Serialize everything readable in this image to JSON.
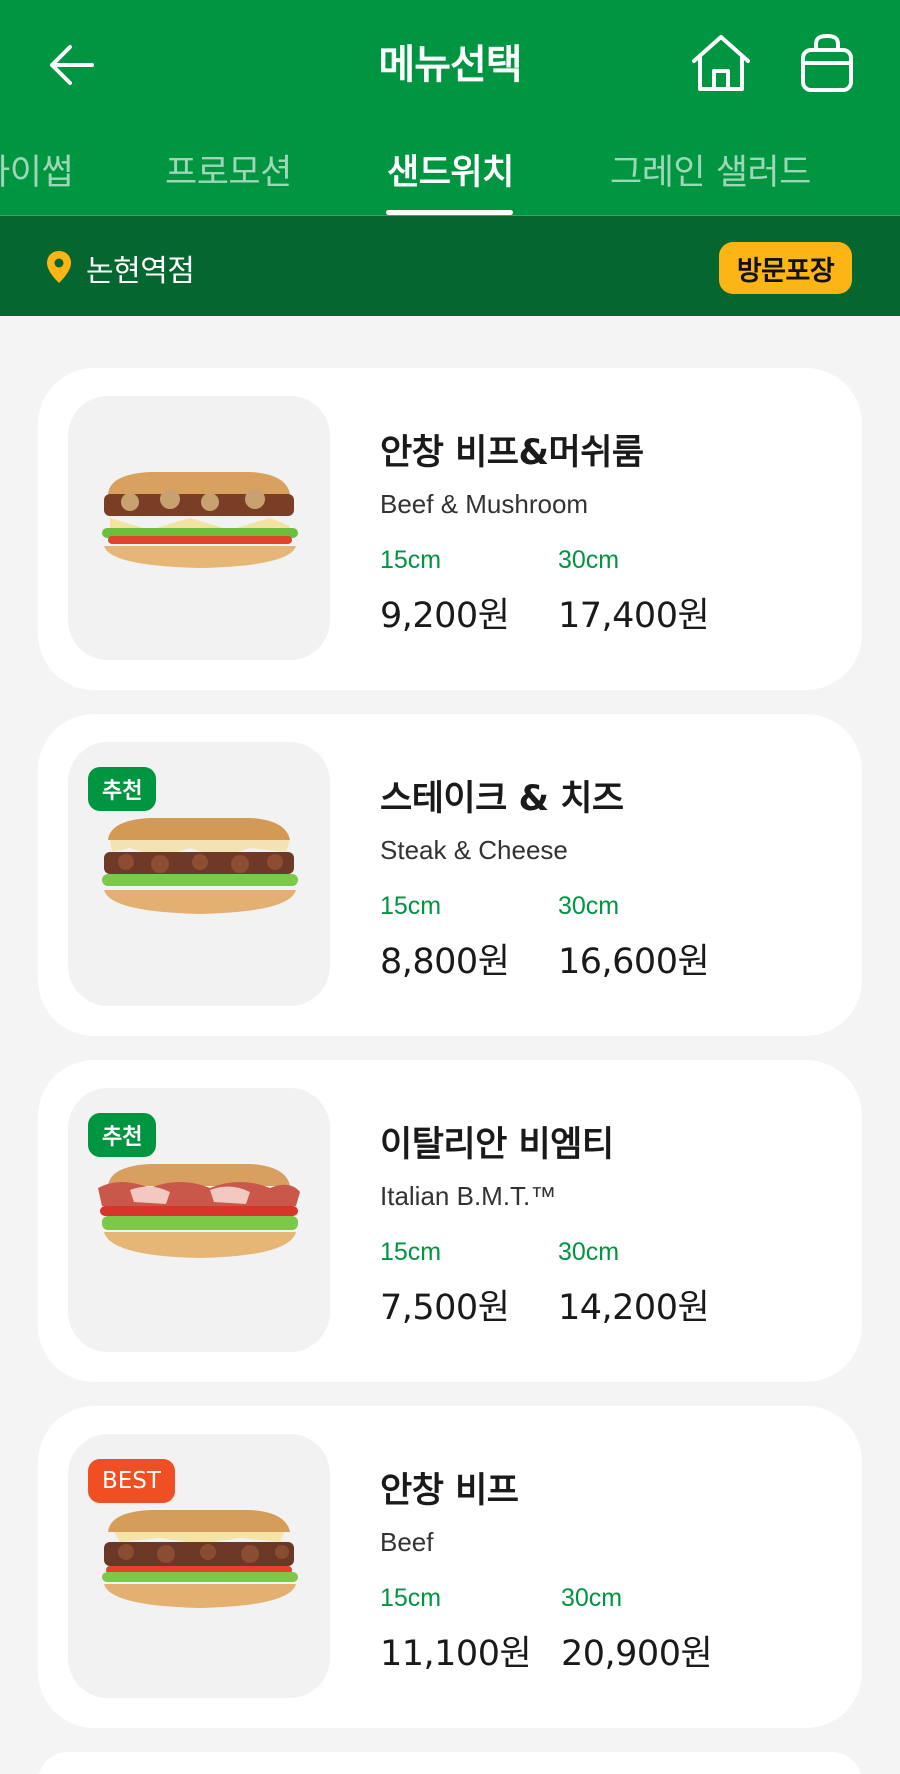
{
  "header": {
    "title": "메뉴선택"
  },
  "tabs": [
    {
      "label": "아이썹"
    },
    {
      "label": "프로모션"
    },
    {
      "label": "샌드위치",
      "active": true
    },
    {
      "label": "그레인 샐러드"
    }
  ],
  "store": {
    "name": "논현역점",
    "order_type": "방문포장"
  },
  "colors": {
    "brand_green": "#009540",
    "dark_green": "#05672f",
    "yellow": "#fdb515",
    "best_red": "#f04e23"
  },
  "menu": [
    {
      "name_ko": "안창 비프&머쉬룸",
      "name_en": "Beef & Mushroom",
      "badge": "",
      "size1": "15cm",
      "price1": "9,200원",
      "size2": "30cm",
      "price2": "17,400원"
    },
    {
      "name_ko": "스테이크 & 치즈",
      "name_en": "Steak & Cheese",
      "badge": "추천",
      "size1": "15cm",
      "price1": "8,800원",
      "size2": "30cm",
      "price2": "16,600원"
    },
    {
      "name_ko": "이탈리안 비엠티",
      "name_en": "Italian B.M.T.™",
      "badge": "추천",
      "size1": "15cm",
      "price1": "7,500원",
      "size2": "30cm",
      "price2": "14,200원"
    },
    {
      "name_ko": "안창 비프",
      "name_en": "Beef",
      "badge": "BEST",
      "size1": "15cm",
      "price1": "11,100원",
      "size2": "30cm",
      "price2": "20,900원"
    }
  ]
}
